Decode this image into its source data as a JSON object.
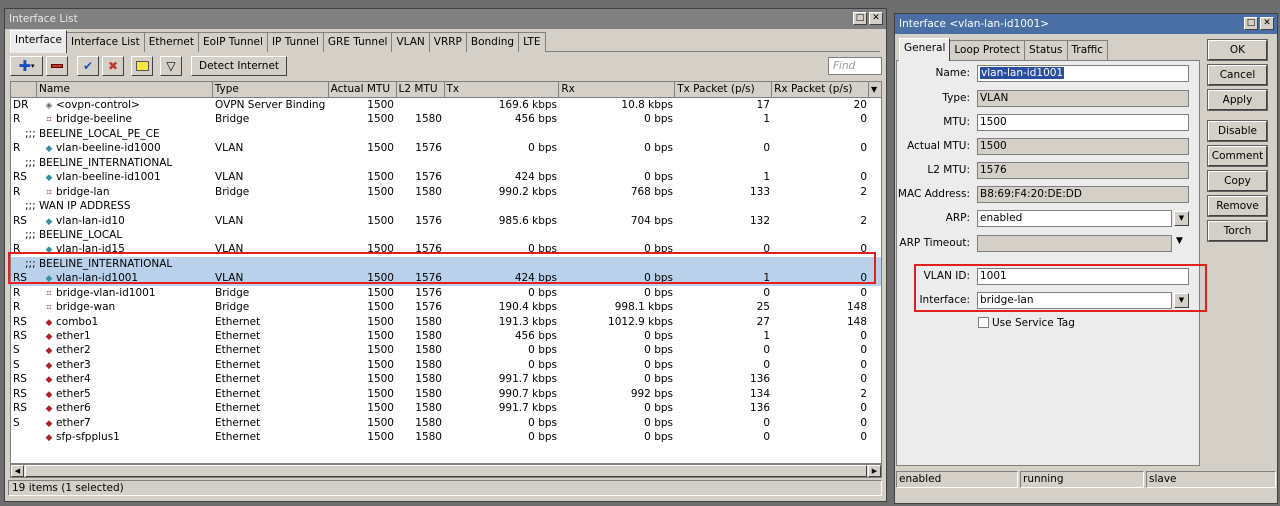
{
  "left_window": {
    "title": "Interface List",
    "tabs": [
      "Interface",
      "Interface List",
      "Ethernet",
      "EoIP Tunnel",
      "IP Tunnel",
      "GRE Tunnel",
      "VLAN",
      "VRRP",
      "Bonding",
      "LTE"
    ],
    "toolbar": {
      "detect_internet": "Detect Internet",
      "find_placeholder": "Find"
    },
    "columns": [
      "",
      "Name",
      "Type",
      "Actual MTU",
      "L2 MTU",
      "Tx",
      "Rx",
      "Tx Packet (p/s)",
      "Rx Packet (p/s)"
    ],
    "rows": [
      {
        "kind": "item",
        "flag": "DR",
        "icon": "ovpn",
        "name": "<ovpn-control>",
        "type": "OVPN Server Binding",
        "mtu": "1500",
        "l2mtu": "",
        "tx": "169.6 kbps",
        "rx": "10.8 kbps",
        "txp": "17",
        "rxp": "20"
      },
      {
        "kind": "item",
        "flag": "R",
        "icon": "bridge",
        "name": "bridge-beeline",
        "type": "Bridge",
        "mtu": "1500",
        "l2mtu": "1580",
        "tx": "456 bps",
        "rx": "0 bps",
        "txp": "1",
        "rxp": "0"
      },
      {
        "kind": "comment",
        "text": ";;; BEELINE_LOCAL_PE_CE"
      },
      {
        "kind": "item",
        "flag": "R",
        "icon": "vlan",
        "name": "vlan-beeline-id1000",
        "type": "VLAN",
        "mtu": "1500",
        "l2mtu": "1576",
        "tx": "0 bps",
        "rx": "0 bps",
        "txp": "0",
        "rxp": "0"
      },
      {
        "kind": "comment",
        "text": ";;; BEELINE_INTERNATIONAL"
      },
      {
        "kind": "item",
        "flag": "RS",
        "icon": "vlan",
        "name": "vlan-beeline-id1001",
        "type": "VLAN",
        "mtu": "1500",
        "l2mtu": "1576",
        "tx": "424 bps",
        "rx": "0 bps",
        "txp": "1",
        "rxp": "0"
      },
      {
        "kind": "item",
        "flag": "R",
        "icon": "bridge",
        "name": "bridge-lan",
        "type": "Bridge",
        "mtu": "1500",
        "l2mtu": "1580",
        "tx": "990.2 kbps",
        "rx": "768 bps",
        "txp": "133",
        "rxp": "2"
      },
      {
        "kind": "comment",
        "text": ";;; WAN IP ADDRESS"
      },
      {
        "kind": "item",
        "flag": "RS",
        "icon": "vlan",
        "name": "vlan-lan-id10",
        "type": "VLAN",
        "mtu": "1500",
        "l2mtu": "1576",
        "tx": "985.6 kbps",
        "rx": "704 bps",
        "txp": "132",
        "rxp": "2"
      },
      {
        "kind": "comment",
        "text": ";;; BEELINE_LOCAL"
      },
      {
        "kind": "item",
        "flag": "R",
        "icon": "vlan",
        "name": "vlan-lan-id15",
        "type": "VLAN",
        "mtu": "1500",
        "l2mtu": "1576",
        "tx": "0 bps",
        "rx": "0 bps",
        "txp": "0",
        "rxp": "0"
      },
      {
        "kind": "comment",
        "text": ";;; BEELINE_INTERNATIONAL",
        "sel": true
      },
      {
        "kind": "item",
        "flag": "RS",
        "icon": "vlan",
        "name": "vlan-lan-id1001",
        "type": "VLAN",
        "mtu": "1500",
        "l2mtu": "1576",
        "tx": "424 bps",
        "rx": "0 bps",
        "txp": "1",
        "rxp": "0",
        "sel": true
      },
      {
        "kind": "item",
        "flag": "R",
        "icon": "bridge",
        "name": "bridge-vlan-id1001",
        "type": "Bridge",
        "mtu": "1500",
        "l2mtu": "1576",
        "tx": "0 bps",
        "rx": "0 bps",
        "txp": "0",
        "rxp": "0"
      },
      {
        "kind": "item",
        "flag": "R",
        "icon": "bridge",
        "name": "bridge-wan",
        "type": "Bridge",
        "mtu": "1500",
        "l2mtu": "1576",
        "tx": "190.4 kbps",
        "rx": "998.1 kbps",
        "txp": "25",
        "rxp": "148"
      },
      {
        "kind": "item",
        "flag": "RS",
        "icon": "ether",
        "name": "combo1",
        "type": "Ethernet",
        "mtu": "1500",
        "l2mtu": "1580",
        "tx": "191.3 kbps",
        "rx": "1012.9 kbps",
        "txp": "27",
        "rxp": "148"
      },
      {
        "kind": "item",
        "flag": "RS",
        "icon": "ether",
        "name": "ether1",
        "type": "Ethernet",
        "mtu": "1500",
        "l2mtu": "1580",
        "tx": "456 bps",
        "rx": "0 bps",
        "txp": "1",
        "rxp": "0"
      },
      {
        "kind": "item",
        "flag": "S",
        "icon": "ether",
        "name": "ether2",
        "type": "Ethernet",
        "mtu": "1500",
        "l2mtu": "1580",
        "tx": "0 bps",
        "rx": "0 bps",
        "txp": "0",
        "rxp": "0"
      },
      {
        "kind": "item",
        "flag": "S",
        "icon": "ether",
        "name": "ether3",
        "type": "Ethernet",
        "mtu": "1500",
        "l2mtu": "1580",
        "tx": "0 bps",
        "rx": "0 bps",
        "txp": "0",
        "rxp": "0"
      },
      {
        "kind": "item",
        "flag": "RS",
        "icon": "ether",
        "name": "ether4",
        "type": "Ethernet",
        "mtu": "1500",
        "l2mtu": "1580",
        "tx": "991.7 kbps",
        "rx": "0 bps",
        "txp": "136",
        "rxp": "0"
      },
      {
        "kind": "item",
        "flag": "RS",
        "icon": "ether",
        "name": "ether5",
        "type": "Ethernet",
        "mtu": "1500",
        "l2mtu": "1580",
        "tx": "990.7 kbps",
        "rx": "992 bps",
        "txp": "134",
        "rxp": "2"
      },
      {
        "kind": "item",
        "flag": "RS",
        "icon": "ether",
        "name": "ether6",
        "type": "Ethernet",
        "mtu": "1500",
        "l2mtu": "1580",
        "tx": "991.7 kbps",
        "rx": "0 bps",
        "txp": "136",
        "rxp": "0"
      },
      {
        "kind": "item",
        "flag": "S",
        "icon": "ether",
        "name": "ether7",
        "type": "Ethernet",
        "mtu": "1500",
        "l2mtu": "1580",
        "tx": "0 bps",
        "rx": "0 bps",
        "txp": "0",
        "rxp": "0"
      },
      {
        "kind": "item",
        "flag": "",
        "icon": "ether",
        "name": "sfp-sfpplus1",
        "type": "Ethernet",
        "mtu": "1500",
        "l2mtu": "1580",
        "tx": "0 bps",
        "rx": "0 bps",
        "txp": "0",
        "rxp": "0"
      }
    ],
    "status": "19 items (1 selected)"
  },
  "right_window": {
    "title": "Interface <vlan-lan-id1001>",
    "tabs": [
      "General",
      "Loop Protect",
      "Status",
      "Traffic"
    ],
    "fields": {
      "name_label": "Name:",
      "name": "vlan-lan-id1001",
      "type_label": "Type:",
      "type": "VLAN",
      "mtu_label": "MTU:",
      "mtu": "1500",
      "actual_mtu_label": "Actual MTU:",
      "actual_mtu": "1500",
      "l2mtu_label": "L2 MTU:",
      "l2mtu": "1576",
      "mac_label": "MAC Address:",
      "mac": "B8:69:F4:20:DE:DD",
      "arp_label": "ARP:",
      "arp": "enabled",
      "arp_timeout_label": "ARP Timeout:",
      "arp_timeout": "",
      "vlan_id_label": "VLAN ID:",
      "vlan_id": "1001",
      "interface_label": "Interface:",
      "interface": "bridge-lan",
      "service_tag_label": "Use Service Tag"
    },
    "buttons": {
      "ok": "OK",
      "cancel": "Cancel",
      "apply": "Apply",
      "disable": "Disable",
      "comment": "Comment",
      "copy": "Copy",
      "remove": "Remove",
      "torch": "Torch"
    },
    "status": {
      "s1": "enabled",
      "s2": "running",
      "s3": "slave"
    }
  },
  "icons": {
    "ovpn": "◈",
    "bridge": "⌗",
    "vlan": "◆",
    "ether": "◆"
  }
}
